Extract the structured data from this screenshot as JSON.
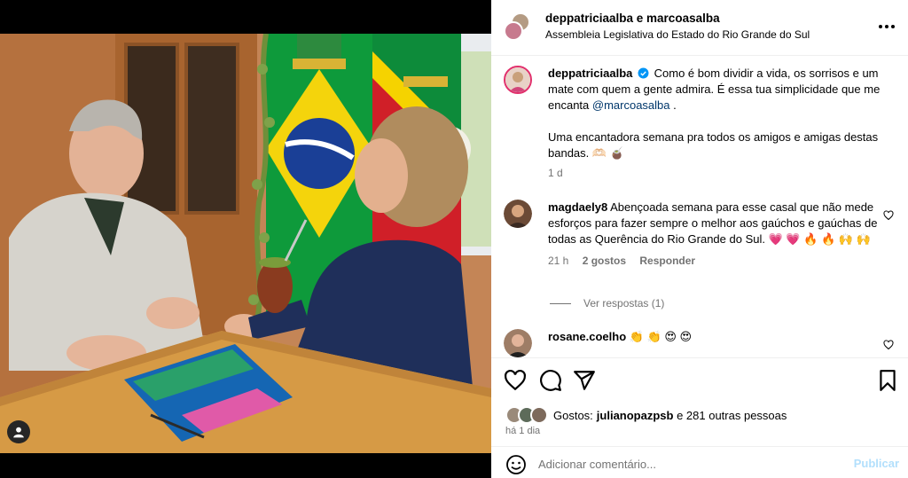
{
  "post": {
    "header_users": "deppatriciaalba e marcoasalba",
    "location": "Assembleia Legislativa do Estado do Rio Grande do Sul"
  },
  "caption": {
    "user": "deppatriciaalba",
    "text_1": "Como é bom dividir a vida, os sorrisos e um mate com quem a gente admira. É essa tua simplicidade que me encanta ",
    "mention": "@marcoasalba",
    "text_2": " .",
    "text_3": "Uma encantadora semana pra todos os amigos e amigas destas bandas. 🫶🏻 🧉",
    "time": "1 d"
  },
  "comments": [
    {
      "user": "magdaely8",
      "text": "Abençoada semana para esse casal que não mede esforços para fazer sempre o melhor aos gaúchos e gaúchas de todas as Querência do Rio Grande do Sul. 💗 💗 🔥 🔥 🙌 🙌",
      "time": "21 h",
      "likes": "2 gostos",
      "reply": "Responder",
      "view_replies": "Ver respostas (1)"
    },
    {
      "user": "rosane.coelho",
      "text": "👏 👏 😍 😍"
    }
  ],
  "likes": {
    "prefix": "Gostos: ",
    "user": "julianopazpsb",
    "suffix": " e 281 outras pessoas"
  },
  "time_ago": "há 1 dia",
  "add_comment": {
    "placeholder": "Adicionar comentário...",
    "publish": "Publicar"
  },
  "icons": [
    "user-tag-icon",
    "more-icon",
    "verified-icon",
    "heart-icon",
    "comment-icon",
    "share-icon",
    "bookmark-icon",
    "emoji-icon"
  ],
  "colors": {
    "link": "#00376b",
    "meta": "#737373",
    "publish": "#b2dffc",
    "verified": "#0095f6"
  }
}
